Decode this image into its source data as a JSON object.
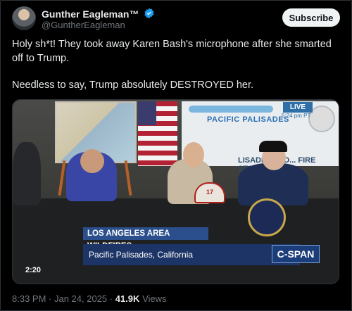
{
  "author": {
    "display_name": "Gunther Eagleman™",
    "handle": "@GuntherEagleman",
    "verified_icon": "verified-badge-icon",
    "accent": "#1d9bf0"
  },
  "actions": {
    "subscribe_label": "Subscribe"
  },
  "post": {
    "paragraph1": "Holy sh*t! They took away Karen Bash's microphone after she smarted off to Trump.",
    "paragraph2": "Needless to say, Trump absolutely DESTROYED her."
  },
  "video": {
    "live_label": "LIVE",
    "live_time": "5:24 pm PT",
    "banner_text": "PACIFIC PALISADES",
    "station_text": "LISADES STO... FIRE STATION",
    "helmet_number": "17",
    "lower_third_title": "LOS ANGELES AREA WILDFIRES",
    "lower_third_location": "Pacific Palisades, California",
    "network": "C-SPAN",
    "duration": "2:20"
  },
  "meta": {
    "time": "8:33 PM",
    "separator": " · ",
    "date": "Jan 24, 2025",
    "views_count": "41.9K",
    "views_label": "Views"
  }
}
